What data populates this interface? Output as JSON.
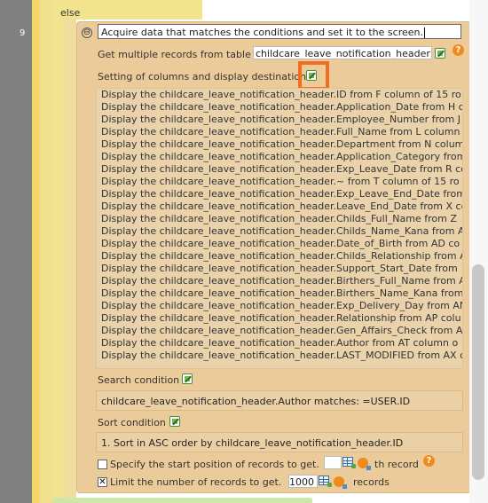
{
  "editor": {
    "line_number": "9",
    "else_label": "else"
  },
  "block": {
    "title": "Acquire data that matches the conditions and set it to the screen.",
    "get_records_label": "Get multiple records from table",
    "table_name": "childcare_leave_notification_header",
    "columns_label": "Setting of columns and display destination",
    "columns": [
      "Display the childcare_leave_notification_header.ID from F column of 15 ro",
      "Display the childcare_leave_notification_header.Application_Date from H c",
      "Display the childcare_leave_notification_header.Employee_Number from J",
      "Display the childcare_leave_notification_header.Full_Name from L column",
      "Display the childcare_leave_notification_header.Department from N colum",
      "Display the childcare_leave_notification_header.Application_Category from",
      "Display the childcare_leave_notification_header.Exp_Leave_Date from R co",
      "Display the childcare_leave_notification_header.~ from T column of 15 ro",
      "Display the childcare_leave_notification_header.Exp_Leave_End_Date from",
      "Display the childcare_leave_notification_header.Leave_End_Date from X co",
      "Display the childcare_leave_notification_header.Childs_Full_Name from Z",
      "Display the childcare_leave_notification_header.Childs_Name_Kana from A",
      "Display the childcare_leave_notification_header.Date_of_Birth from AD co",
      "Display the childcare_leave_notification_header.Childs_Relationship from A",
      "Display the childcare_leave_notification_header.Support_Start_Date from",
      "Display the childcare_leave_notification_header.Birthers_Full_Name from A",
      "Display the childcare_leave_notification_header.Birthers_Name_Kana from",
      "Display the childcare_leave_notification_header.Exp_Delivery_Day from AN",
      "Display the childcare_leave_notification_header.Relationship from AP colu",
      "Display the childcare_leave_notification_header.Gen_Affairs_Check from A",
      "Display the childcare_leave_notification_header.Author from AT column o",
      "Display the childcare_leave_notification_header.LAST_MODIFIED from AX c"
    ],
    "search_condition_label": "Search condition",
    "search_condition_value": "childcare_leave_notification_header.Author matches: =USER.ID",
    "sort_condition_label": "Sort condition",
    "sort_condition_value": "1. Sort in ASC order by childcare_leave_notification_header.ID",
    "start_position_label": "Specify the start position of records to get.",
    "start_position_value": "",
    "start_position_suffix": "th record",
    "start_position_checked": false,
    "limit_label": "Limit the number of records to get.",
    "limit_value": "1000",
    "limit_suffix": "records",
    "limit_checked": true,
    "help_symbol": "?",
    "collapse_symbol": "⊖"
  },
  "colors": {
    "panel": "#eccb9a",
    "focus": "#f26d1f",
    "gutter": "#808080"
  }
}
